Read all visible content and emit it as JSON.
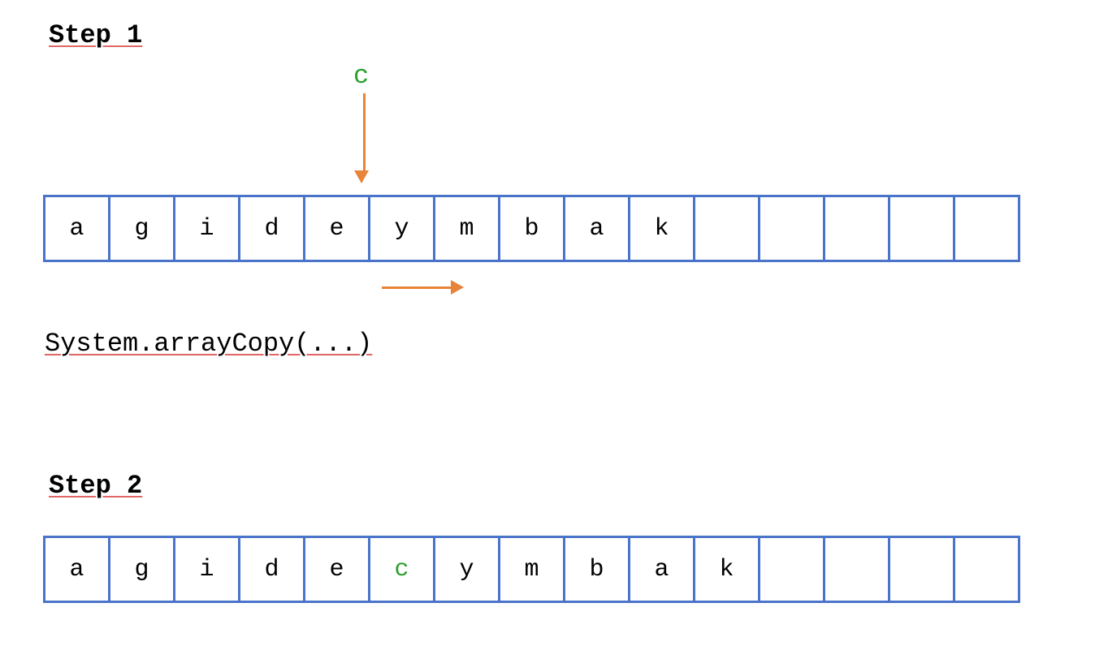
{
  "step1": {
    "title": "Step 1",
    "insert_char": "c",
    "cells": [
      "a",
      "g",
      "i",
      "d",
      "e",
      "y",
      "m",
      "b",
      "a",
      "k",
      "",
      "",
      "",
      "",
      ""
    ],
    "caption": "System.arrayCopy(...)"
  },
  "step2": {
    "title": "Step 2",
    "cells": [
      "a",
      "g",
      "i",
      "d",
      "e",
      "c",
      "y",
      "m",
      "b",
      "a",
      "k",
      "",
      "",
      "",
      ""
    ],
    "highlight_index": 5
  },
  "colors": {
    "cell_border": "#4a74c9",
    "arrow": "#e8833a",
    "insert": "#2aa02a"
  }
}
